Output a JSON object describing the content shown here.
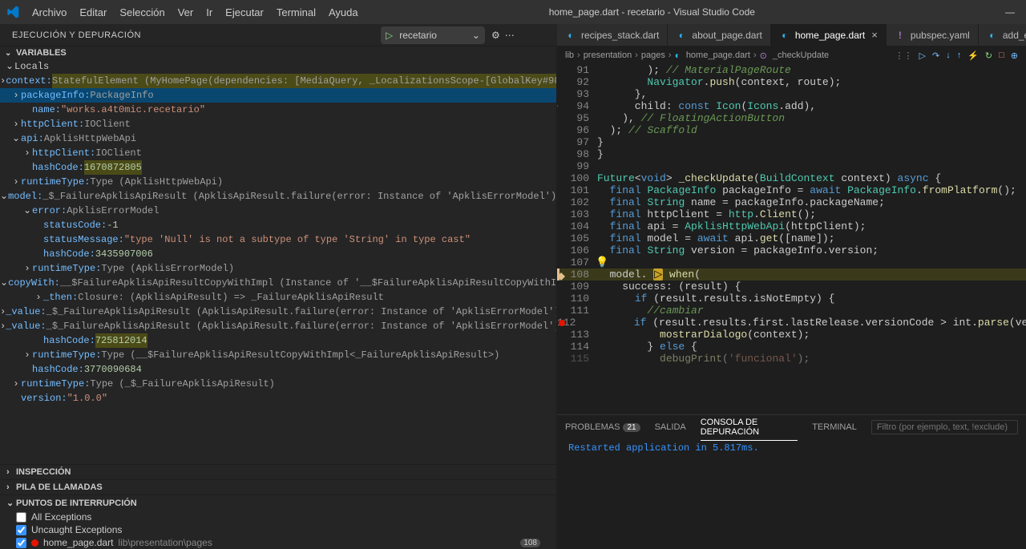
{
  "menubar": {
    "items": [
      "Archivo",
      "Editar",
      "Selección",
      "Ver",
      "Ir",
      "Ejecutar",
      "Terminal",
      "Ayuda"
    ],
    "title": "home_page.dart - recetario - Visual Studio Code"
  },
  "action": {
    "run_title": "EJECUCIÓN Y DEPURACIÓN",
    "config": "recetario",
    "gear": "⚙",
    "more": "⋯"
  },
  "tabs": [
    {
      "label": "recipes_stack.dart",
      "icon": "dart",
      "active": false,
      "close": false
    },
    {
      "label": "about_page.dart",
      "icon": "dart",
      "active": false,
      "close": false
    },
    {
      "label": "home_page.dart",
      "icon": "dart",
      "active": true,
      "close": true
    },
    {
      "label": "pubspec.yaml",
      "icon": "pub",
      "active": false,
      "close": false
    },
    {
      "label": "add_edit_rec",
      "icon": "dart",
      "active": false,
      "close": false
    }
  ],
  "breadcrumb": [
    "lib",
    "presentation",
    "pages",
    "home_page.dart",
    "_checkUpdate"
  ],
  "debug_toolbar": [
    "grip",
    "continue",
    "step-over",
    "step-into",
    "step-out",
    "hot-reload",
    "restart",
    "stop",
    "magnify"
  ],
  "variables": {
    "title": "VARIABLES",
    "locals": "Locals",
    "rows": [
      {
        "indent": 1,
        "arrow": "closed",
        "k": "context:",
        "v": " StatefulElement (MyHomePage(dependencies: [MediaQuery, _LocalizationsScope-[GlobalKey#98b22], _Inhe…",
        "hl": true,
        "sel": false
      },
      {
        "indent": 1,
        "arrow": "closed",
        "k": "packageInfo: ",
        "v": "PackageInfo",
        "sel": true
      },
      {
        "indent": 2,
        "arrow": "blank",
        "k": "name: ",
        "v": "\"works.a4t0mic.recetario\"",
        "cls": "v"
      },
      {
        "indent": 1,
        "arrow": "closed",
        "k": "httpClient: ",
        "v": "IOClient",
        "cls": "g"
      },
      {
        "indent": 1,
        "arrow": "open",
        "k": "api: ",
        "v": "ApklisHttpWebApi",
        "cls": "g"
      },
      {
        "indent": 2,
        "arrow": "closed",
        "k": "httpClient: ",
        "v": "IOClient",
        "cls": "g"
      },
      {
        "indent": 2,
        "arrow": "blank",
        "k": "hashCode: ",
        "v": "1670872805",
        "cls": "n",
        "hlv": true
      },
      {
        "indent": 1,
        "arrow": "closed",
        "k": "runtimeType: ",
        "v": "Type (ApklisHttpWebApi)",
        "cls": "g"
      },
      {
        "indent": 1,
        "arrow": "open",
        "k": "model: ",
        "v": "_$_FailureApklisApiResult (ApklisApiResult.failure(error: Instance of 'ApklisErrorModel'))",
        "cls": "g"
      },
      {
        "indent": 2,
        "arrow": "open",
        "k": "error: ",
        "v": "ApklisErrorModel",
        "cls": "g"
      },
      {
        "indent": 3,
        "arrow": "blank",
        "k": "statusCode: ",
        "v": "-1",
        "cls": "n"
      },
      {
        "indent": 3,
        "arrow": "blank",
        "k": "statusMessage: ",
        "v": "\"type 'Null' is not a subtype of type 'String' in type cast\"",
        "cls": "v"
      },
      {
        "indent": 3,
        "arrow": "blank",
        "k": "hashCode: ",
        "v": "3435907006",
        "cls": "n"
      },
      {
        "indent": 2,
        "arrow": "closed",
        "k": "runtimeType: ",
        "v": "Type (ApklisErrorModel)",
        "cls": "g"
      },
      {
        "indent": 2,
        "arrow": "open",
        "k": "copyWith: ",
        "v": "__$FailureApklisApiResultCopyWithImpl (Instance of '__$FailureApklisApiResultCopyWithImpl<_Failur…",
        "cls": "g"
      },
      {
        "indent": 3,
        "arrow": "closed",
        "k": "_then: ",
        "v": "Closure: (ApklisApiResult) => _FailureApklisApiResult",
        "cls": "g"
      },
      {
        "indent": 3,
        "arrow": "closed",
        "k": "_value: ",
        "v": "_$_FailureApklisApiResult (ApklisApiResult.failure(error: Instance of 'ApklisErrorModel'))",
        "cls": "g"
      },
      {
        "indent": 3,
        "arrow": "closed",
        "k": "_value: ",
        "v": "_$_FailureApklisApiResult (ApklisApiResult.failure(error: Instance of 'ApklisErrorModel'))",
        "cls": "g"
      },
      {
        "indent": 3,
        "arrow": "blank",
        "k": "hashCode: ",
        "v": "725812014",
        "cls": "n",
        "hlv": true
      },
      {
        "indent": 2,
        "arrow": "closed",
        "k": "runtimeType: ",
        "v": "Type (__$FailureApklisApiResultCopyWithImpl<_FailureApklisApiResult>)",
        "cls": "g"
      },
      {
        "indent": 2,
        "arrow": "blank",
        "k": "hashCode: ",
        "v": "3770090684",
        "cls": "n"
      },
      {
        "indent": 1,
        "arrow": "closed",
        "k": "runtimeType: ",
        "v": "Type (_$_FailureApklisApiResult)",
        "cls": "g"
      },
      {
        "indent": 1,
        "arrow": "blank",
        "k": "version: ",
        "v": "\"1.0.0\"",
        "cls": "v"
      }
    ]
  },
  "watch_title": "INSPECCIÓN",
  "callstack_title": "PILA DE LLAMADAS",
  "breakpoints": {
    "title": "PUNTOS DE INTERRUPCIÓN",
    "all": "All Exceptions",
    "uncaught": "Uncaught Exceptions",
    "file": "home_page.dart",
    "path": "lib\\presentation\\pages",
    "line": "108"
  },
  "code": {
    "start": 91,
    "lines": [
      {
        "n": 91,
        "t": "        ); // MaterialPageRoute",
        "seg": [
          [
            8,
            "p"
          ],
          [
            2,
            "cmt",
            " // MaterialPageRoute"
          ]
        ]
      },
      {
        "n": 92,
        "t": "        Navigator.push(context, route);"
      },
      {
        "n": 93,
        "t": "      },"
      },
      {
        "n": 94,
        "t": "      child: const Icon(Icons.add),",
        "plus": true
      },
      {
        "n": 95,
        "t": "    ), // FloatingActionButton"
      },
      {
        "n": 96,
        "t": "  ); // Scaffold"
      },
      {
        "n": 97,
        "t": "}"
      },
      {
        "n": 98,
        "t": "}"
      },
      {
        "n": 99,
        "t": ""
      },
      {
        "n": 100,
        "t": "Future<void> _checkUpdate(BuildContext context) async {"
      },
      {
        "n": 101,
        "t": "  final PackageInfo packageInfo = await PackageInfo.fromPlatform();"
      },
      {
        "n": 102,
        "t": "  final String name = packageInfo.packageName;"
      },
      {
        "n": 103,
        "t": "  final httpClient = http.Client();"
      },
      {
        "n": 104,
        "t": "  final api = ApklisHttpWebApi(httpClient);"
      },
      {
        "n": 105,
        "t": "  final model = await api.get([name]);"
      },
      {
        "n": 106,
        "t": "  final String version = packageInfo.version;"
      },
      {
        "n": 107,
        "t": "",
        "bulb": true
      },
      {
        "n": 108,
        "t": "  model. when(",
        "exec": true,
        "bpexc": true
      },
      {
        "n": 109,
        "t": "    success: (result) {"
      },
      {
        "n": 110,
        "t": "      if (result.results.isNotEmpty) {"
      },
      {
        "n": 111,
        "t": "        //cambiar"
      },
      {
        "n": 112,
        "t": "        if (result.results.first.lastRelease.versionCode > int.parse(ver",
        "bp": true
      },
      {
        "n": 113,
        "t": "          mostrarDialogo(context);"
      },
      {
        "n": 114,
        "t": "        } else {"
      },
      {
        "n": 115,
        "t": "          debugPrint('funcional');",
        "fade": true
      }
    ]
  },
  "panel": {
    "tabs": {
      "problems": "PROBLEMAS",
      "problems_count": "21",
      "output": "SALIDA",
      "debug": "CONSOLA DE DEPURACIÓN",
      "terminal": "TERMINAL"
    },
    "filter_placeholder": "Filtro (por ejemplo, text, !exclude)",
    "console_line": "Restarted application in 5.817ms."
  }
}
